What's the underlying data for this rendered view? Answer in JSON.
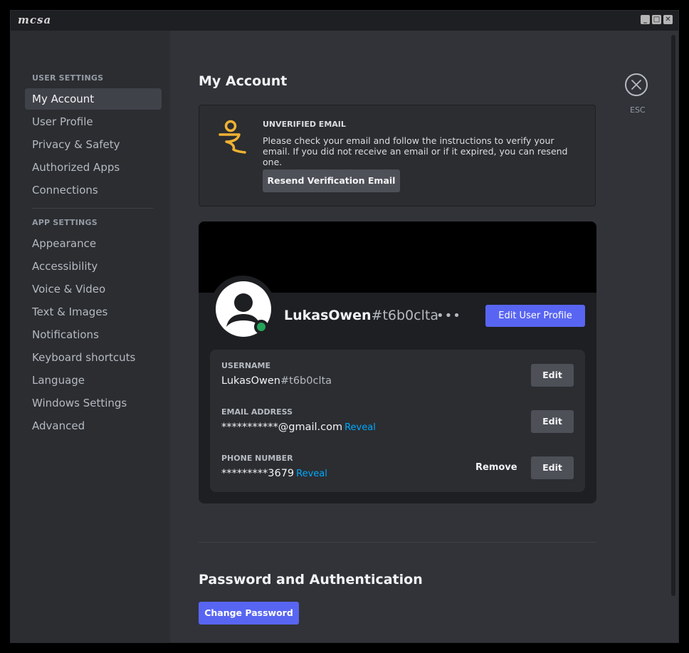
{
  "app": {
    "logo": "mcsa",
    "window_buttons": [
      "_",
      "□",
      "✕"
    ]
  },
  "sidebar": {
    "user_settings_header": "USER SETTINGS",
    "user_items": [
      {
        "label": "My Account",
        "active": true
      },
      {
        "label": "User Profile"
      },
      {
        "label": "Privacy & Safety"
      },
      {
        "label": "Authorized Apps"
      },
      {
        "label": "Connections"
      }
    ],
    "app_settings_header": "APP SETTINGS",
    "app_items": [
      {
        "label": "Appearance"
      },
      {
        "label": "Accessibility"
      },
      {
        "label": "Voice & Video"
      },
      {
        "label": "Text & Images"
      },
      {
        "label": "Notifications"
      },
      {
        "label": "Keyboard shortcuts"
      },
      {
        "label": "Language"
      },
      {
        "label": "Windows Settings"
      },
      {
        "label": "Advanced"
      }
    ]
  },
  "main": {
    "title": "My Account",
    "close_label": "ESC",
    "notice": {
      "title": "UNVERIFIED EMAIL",
      "text": "Please check your email and follow the instructions to verify your email. If you did not receive an email or if it expired, you can resend one.",
      "button": "Resend Verification Email"
    },
    "profile": {
      "name": "LukasOwen",
      "tag": "#t6b0clta",
      "more": "•••",
      "edit_profile_button": "Edit User Profile",
      "status_color": "#23a55a",
      "fields": [
        {
          "label": "USERNAME",
          "value": "LukasOwen",
          "value_tag": "#t6b0clta",
          "edit": "Edit"
        },
        {
          "label": "EMAIL ADDRESS",
          "value": "***********@gmail.com",
          "reveal": "Reveal",
          "edit": "Edit"
        },
        {
          "label": "PHONE NUMBER",
          "value": "*********3679",
          "reveal": "Reveal",
          "remove": "Remove",
          "edit": "Edit"
        }
      ]
    },
    "password_section": {
      "title": "Password and Authentication",
      "button": "Change Password"
    }
  },
  "colors": {
    "accent": "#5865f2",
    "link": "#00a8fc",
    "warning": "#f0b232",
    "online": "#23a55a"
  }
}
